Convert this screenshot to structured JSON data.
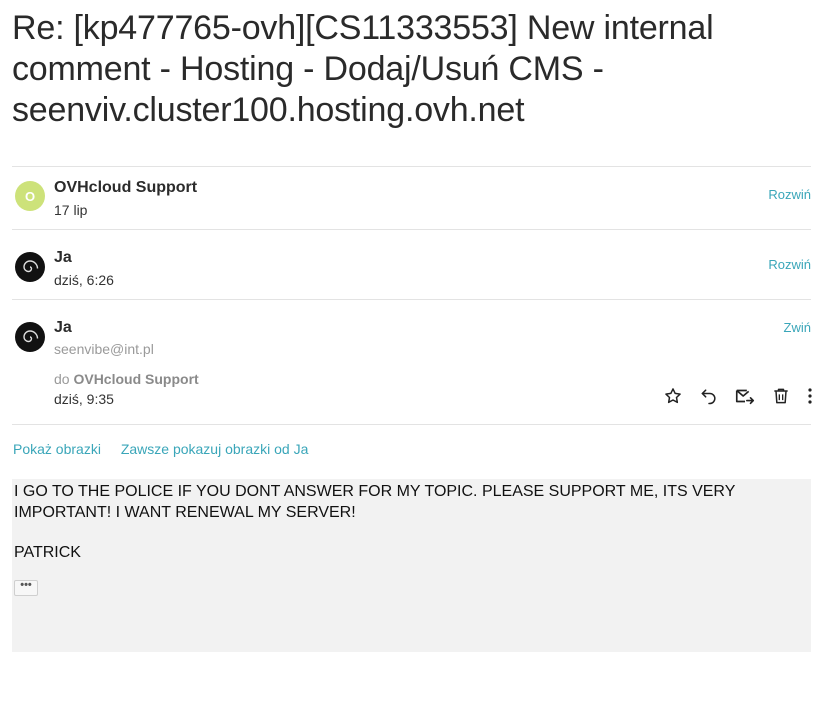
{
  "subject": "Re: [kp477765-ovh][CS11333553] New internal comment - Hosting - Dodaj/Usuń CMS - seenviv.cluster100.hosting.ovh.net",
  "messages": [
    {
      "avatar_letter": "O",
      "avatar_color": "#cde27a",
      "sender": "OVHcloud Support",
      "date": "17 lip",
      "toggle": "Rozwiń"
    },
    {
      "avatar_icon": "spiral-avatar-icon",
      "sender": "Ja",
      "date": "dziś, 6:26",
      "toggle": "Rozwiń"
    },
    {
      "avatar_icon": "spiral-avatar-icon",
      "sender": "Ja",
      "email": "seenvibe@int.pl",
      "to_prefix": "do",
      "to_name": "OVHcloud Support",
      "date": "dziś, 9:35",
      "toggle": "Zwiń",
      "actions": [
        "star-icon",
        "reply-icon",
        "move-icon",
        "delete-icon",
        "more-icon"
      ]
    }
  ],
  "images": {
    "show_label": "Pokaż obrazki",
    "always_show_label": "Zawsze pokazuj obrazki od Ja"
  },
  "body": {
    "text": "I GO TO THE POLICE IF YOU DONT ANSWER FOR MY TOPIC. PLEASE SUPPORT ME, ITS VERY IMPORTANT! I WANT RENEWAL MY SERVER!",
    "signature": "PATRICK",
    "ellipsis": "•••"
  },
  "colors": {
    "link": "#3aa6b9",
    "body_bg": "#f2f2f2",
    "divider": "#e3e3e3"
  }
}
